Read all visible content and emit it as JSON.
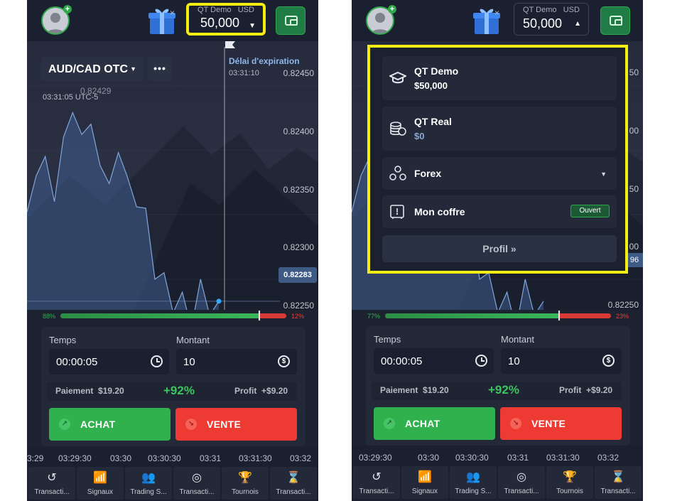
{
  "header": {
    "account_label": "QT Demo",
    "currency": "USD",
    "balance": "50,000",
    "gift_close": "×"
  },
  "asset": {
    "pair": "AUD/CAD OTC",
    "more": "•••",
    "server_time": "03:31:05 UTC-5",
    "peak_label": "0.82429",
    "expiry_label": "Délai d'expiration",
    "expiry_time": "03:31:10",
    "current_price": "0.82283",
    "current_price_right_partial": "96"
  },
  "price_axis_left": [
    "0.82450",
    "0.82400",
    "0.82350",
    "0.82300",
    "0.82250"
  ],
  "price_axis_right": [
    "50",
    "00",
    "50",
    "00",
    "0.82250"
  ],
  "sentiment_left": {
    "up": 88,
    "down": 12,
    "up_label": "88%",
    "down_label": "12%"
  },
  "sentiment_right": {
    "up": 77,
    "down": 23,
    "up_label": "77%",
    "down_label": "23%"
  },
  "trade": {
    "time_label": "Temps",
    "time_value": "00:00:05",
    "amount_label": "Montant",
    "amount_value": "10",
    "payout_label": "Paiement",
    "payout_value": "$19.20",
    "payout_percent": "+92%",
    "profit_label": "Profit",
    "profit_value": "+$9.20",
    "buy_label": "ACHAT",
    "sell_label": "VENTE"
  },
  "time_axis_left": [
    "3:29",
    "03:29:30",
    "03:30",
    "03:30:30",
    "03:31",
    "03:31:30",
    "03:32"
  ],
  "time_axis_right": [
    "03:29:30",
    "03:30",
    "03:30:30",
    "03:31",
    "03:31:30",
    "03:32"
  ],
  "nav": [
    {
      "label": "Transacti...",
      "icon": "history-icon"
    },
    {
      "label": "Signaux",
      "icon": "signal-icon"
    },
    {
      "label": "Trading S...",
      "icon": "social-trading-icon"
    },
    {
      "label": "Transacti...",
      "icon": "target-icon"
    },
    {
      "label": "Tournois",
      "icon": "trophy-icon"
    },
    {
      "label": "Transacti...",
      "icon": "hourglass-icon"
    }
  ],
  "account_menu": {
    "demo_title": "QT Demo",
    "demo_balance": "$50,000",
    "real_title": "QT Real",
    "real_balance": "$0",
    "forex_title": "Forex",
    "vault_title": "Mon coffre",
    "vault_status": "Ouvert",
    "profile_button": "Profil »"
  },
  "colors": {
    "background": "#1d2231",
    "panel": "#232938",
    "buy": "#30b14e",
    "sell": "#ed3b33",
    "highlight": "#f5ec12",
    "accent_green": "#2ea84b",
    "chart_line": "#7fa6dc"
  },
  "chart_data": {
    "type": "area",
    "x": [
      "03:29:15",
      "03:29:20",
      "03:29:25",
      "03:29:30",
      "03:29:35",
      "03:29:40",
      "03:29:45",
      "03:29:50",
      "03:29:55",
      "03:30:00",
      "03:30:05",
      "03:30:10",
      "03:30:15",
      "03:30:20",
      "03:30:25",
      "03:30:30",
      "03:30:35",
      "03:30:40",
      "03:30:45",
      "03:30:50",
      "03:31:00",
      "03:31:05"
    ],
    "values": [
      0.82352,
      0.8238,
      0.82395,
      0.8236,
      0.8241,
      0.82429,
      0.82412,
      0.8242,
      0.82388,
      0.82374,
      0.82398,
      0.82379,
      0.82356,
      0.82355,
      0.823,
      0.82305,
      0.82274,
      0.8229,
      0.82262,
      0.823,
      0.82272,
      0.82283
    ],
    "ylim": [
      0.8224,
      0.8246
    ],
    "yticks": [
      "0.82450",
      "0.82400",
      "0.82350",
      "0.82300",
      "0.82250"
    ]
  }
}
